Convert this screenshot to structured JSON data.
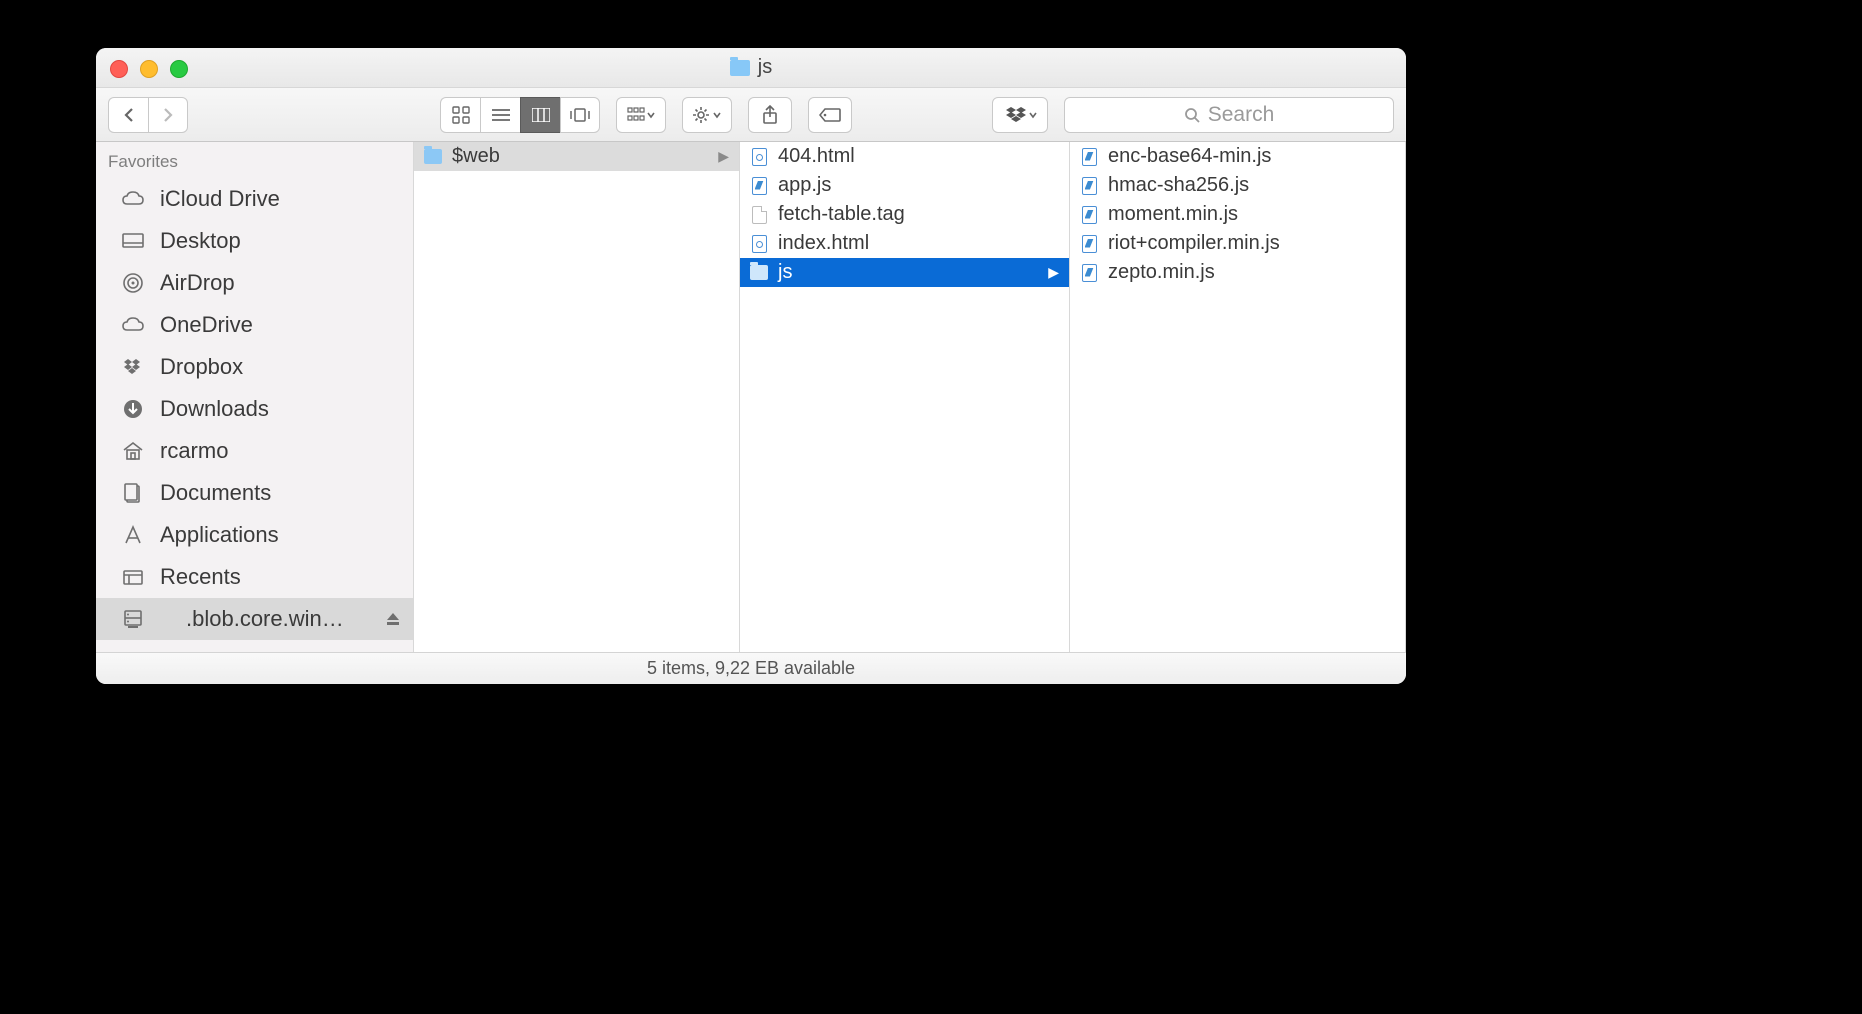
{
  "window": {
    "title": "js"
  },
  "toolbar": {
    "search_placeholder": "Search"
  },
  "sidebar": {
    "header": "Favorites",
    "items": [
      {
        "label": "iCloud Drive",
        "icon": "cloud"
      },
      {
        "label": "Desktop",
        "icon": "desktop"
      },
      {
        "label": "AirDrop",
        "icon": "airdrop"
      },
      {
        "label": "OneDrive",
        "icon": "cloud"
      },
      {
        "label": "Dropbox",
        "icon": "dropbox"
      },
      {
        "label": "Downloads",
        "icon": "downloads"
      },
      {
        "label": "rcarmo",
        "icon": "home"
      },
      {
        "label": "Documents",
        "icon": "documents"
      },
      {
        "label": "Applications",
        "icon": "applications"
      },
      {
        "label": "Recents",
        "icon": "recents"
      },
      {
        "label": ".blob.core.win…",
        "icon": "server",
        "selected": true,
        "ejectable": true
      }
    ]
  },
  "columns": [
    {
      "items": [
        {
          "name": "$web",
          "type": "folder",
          "highlight": true,
          "hasChildren": true
        }
      ]
    },
    {
      "items": [
        {
          "name": "404.html",
          "type": "html"
        },
        {
          "name": "app.js",
          "type": "code"
        },
        {
          "name": "fetch-table.tag",
          "type": "plain"
        },
        {
          "name": "index.html",
          "type": "html"
        },
        {
          "name": "js",
          "type": "folder",
          "selected": true,
          "hasChildren": true
        }
      ]
    },
    {
      "items": [
        {
          "name": "enc-base64-min.js",
          "type": "code"
        },
        {
          "name": "hmac-sha256.js",
          "type": "code"
        },
        {
          "name": "moment.min.js",
          "type": "code"
        },
        {
          "name": "riot+compiler.min.js",
          "type": "code"
        },
        {
          "name": "zepto.min.js",
          "type": "code"
        }
      ]
    }
  ],
  "status": "5 items, 9,22 EB available"
}
